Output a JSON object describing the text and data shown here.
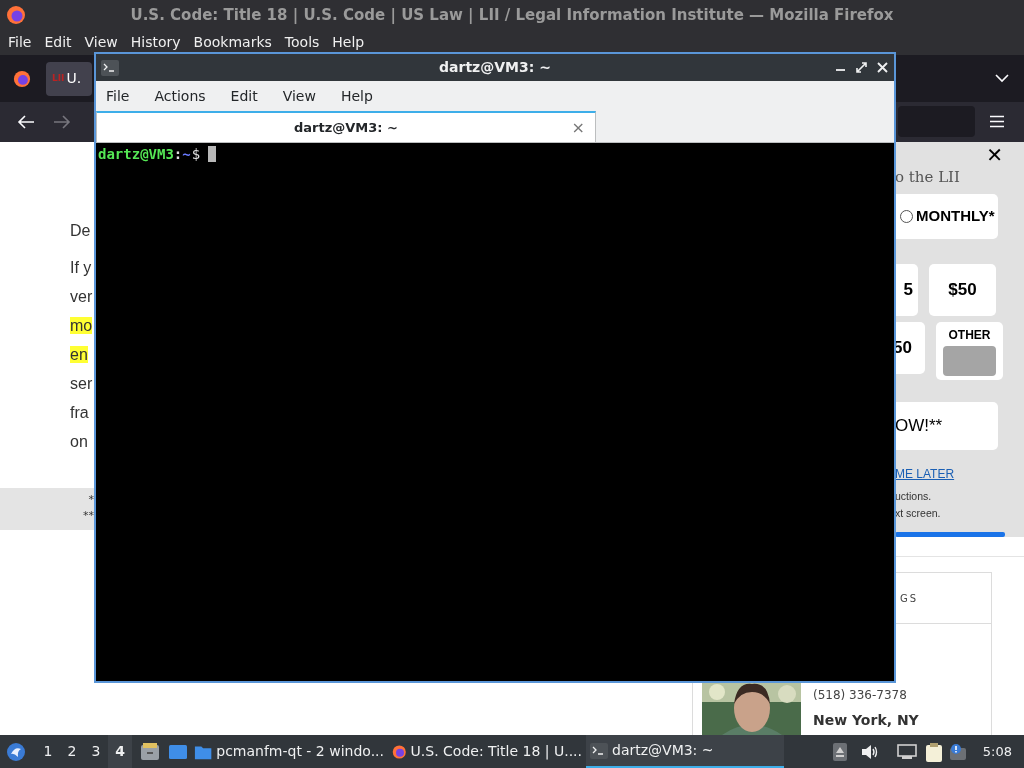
{
  "firefox": {
    "title": "U.S. Code: Title 18 | U.S. Code | US Law | LII / Legal Information Institute — Mozilla Firefox",
    "menu": [
      "File",
      "Edit",
      "View",
      "History",
      "Bookmarks",
      "Tools",
      "Help"
    ],
    "tab": {
      "favicon": "LII",
      "label": "U."
    },
    "page": {
      "lines": [
        {
          "text": "De",
          "highlighted": false
        },
        {
          "text": "If y",
          "highlighted": false
        },
        {
          "text": "ver",
          "highlighted": false
        },
        {
          "text": "mo",
          "highlighted": true
        },
        {
          "text": "en",
          "highlighted": true
        },
        {
          "text": "ser",
          "highlighted": false
        },
        {
          "text": "fra",
          "highlighted": false
        },
        {
          "text": "on",
          "highlighted": false
        }
      ],
      "footnote_marks": [
        "*",
        "**"
      ],
      "donation": {
        "close": "✕",
        "heading": "o the LII",
        "frequency": {
          "label": "MONTHLY*",
          "selected": false
        },
        "amounts": [
          "5",
          "$50",
          "50"
        ],
        "other_label": "OTHER",
        "donate_button": "OW!**",
        "later_link": "ME LATER",
        "notes": [
          "uctions.",
          "xt screen."
        ]
      },
      "listing": {
        "heading": "GS",
        "phone": "(518) 336-7378",
        "city": "New York, NY"
      }
    }
  },
  "terminal": {
    "title": "dartz@VM3: ~",
    "menu": [
      "File",
      "Actions",
      "Edit",
      "View",
      "Help"
    ],
    "tab": "dartz@VM3: ~",
    "tab_close": "×",
    "prompt": {
      "user": "dartz@VM3",
      "separator": ":",
      "path": "~",
      "symbol": "$"
    }
  },
  "taskbar": {
    "workspaces": [
      {
        "label": "1",
        "selected": false
      },
      {
        "label": "2",
        "selected": false
      },
      {
        "label": "3",
        "selected": false
      },
      {
        "label": "4",
        "selected": true
      }
    ],
    "tasks": [
      {
        "kind": "folder",
        "label": "pcmanfm-qt - 2 windo...",
        "selected": false
      },
      {
        "kind": "browser",
        "label": "U.S. Code: Title 18 | U....",
        "selected": false
      },
      {
        "kind": "terminal",
        "label": "dartz@VM3: ~",
        "selected": true
      }
    ],
    "clock": "5:08"
  }
}
